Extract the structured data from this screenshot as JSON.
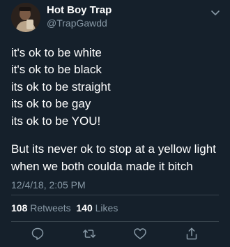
{
  "user": {
    "display_name": "Hot Boy Trap",
    "handle": "@TrapGawdd",
    "avatar_icon": "profile-photo"
  },
  "tweet": {
    "lines": [
      "it's ok to be white",
      "it's ok to be black",
      "its ok to be straight",
      "its ok to be gay",
      "its ok to be YOU!"
    ],
    "paragraph": "But its never ok to stop at a yellow light when we both coulda made it bitch",
    "timestamp": "12/4/18, 2:05 PM"
  },
  "stats": {
    "retweets_count": "108",
    "retweets_label": "Retweets",
    "likes_count": "140",
    "likes_label": "Likes"
  },
  "actions": {
    "reply_icon": "reply-icon",
    "retweet_icon": "retweet-icon",
    "like_icon": "heart-icon",
    "share_icon": "share-icon"
  },
  "colors": {
    "background": "#15202b",
    "text_primary": "#ffffff",
    "text_secondary": "#8899a6",
    "divider": "#38444d"
  }
}
